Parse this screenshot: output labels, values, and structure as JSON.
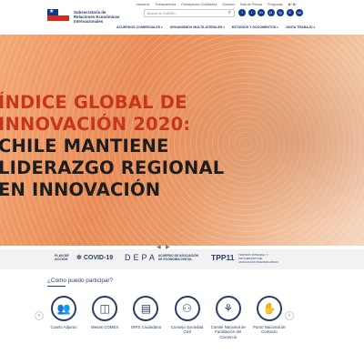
{
  "util_links": [
    "Nosotros",
    "Transparencia",
    "Participación Ciudadana",
    "Glosario",
    "Sala de Prensa",
    "Preguntas"
  ],
  "util_ax": "A⁺ A⁻",
  "org": {
    "name_line1": "Subsecretaría de",
    "name_line2": "Relaciones Económicas",
    "name_line3": "Internacionales"
  },
  "search": {
    "placeholder": "Buscar en SUBREI...",
    "icon": "search-icon"
  },
  "social": [
    "f",
    "t",
    "in",
    "yt",
    "ig",
    "fl",
    "sp"
  ],
  "nav": [
    "ACUERDOS COMERCIALES",
    "ORGANISMOS MULTILATERALES",
    "ESTUDIOS Y DOCUMENTOS",
    "JUNTA TRABAJO"
  ],
  "hero": {
    "line1": "ÍNDICE GLOBAL DE",
    "line2": "INNOVACIÓN 2020:",
    "line3": "CHILE MANTIENE",
    "line4": "LIDERAZGO REGIONAL",
    "line5": "EN INNOVACIÓN"
  },
  "strip": {
    "plan_l1": "PLAN DE",
    "plan_l2": "ACCIÓN",
    "covid": "COVID-19",
    "depa": "DEPA",
    "depa_sub_l1": "ACUERDO DE ASOCIACIÓN",
    "depa_sub_l2": "DE ECONOMÍA DIGITAL",
    "tpp": "TPP11",
    "tpp_sub": "TRATADO INTEGRAL Y PROGRESISTA DE ASOCIACIÓN TRANSPACÍFICO"
  },
  "participate": {
    "title": "¿Cómo puedo participar?",
    "cards": [
      {
        "label": "Cuarto Adjunto",
        "icon": "people-group-icon"
      },
      {
        "label": "Mesas COMEX",
        "icon": "meeting-table-icon"
      },
      {
        "label": "OIRS Ciudadana",
        "icon": "document-icon"
      },
      {
        "label": "Consejo Sociedad Civil",
        "icon": "council-icon"
      },
      {
        "label": "Comité Nacional de Facilitación del Comercio",
        "icon": "committee-icon"
      },
      {
        "label": "Punto Nacional de Contacto",
        "icon": "handshake-icon"
      }
    ]
  }
}
